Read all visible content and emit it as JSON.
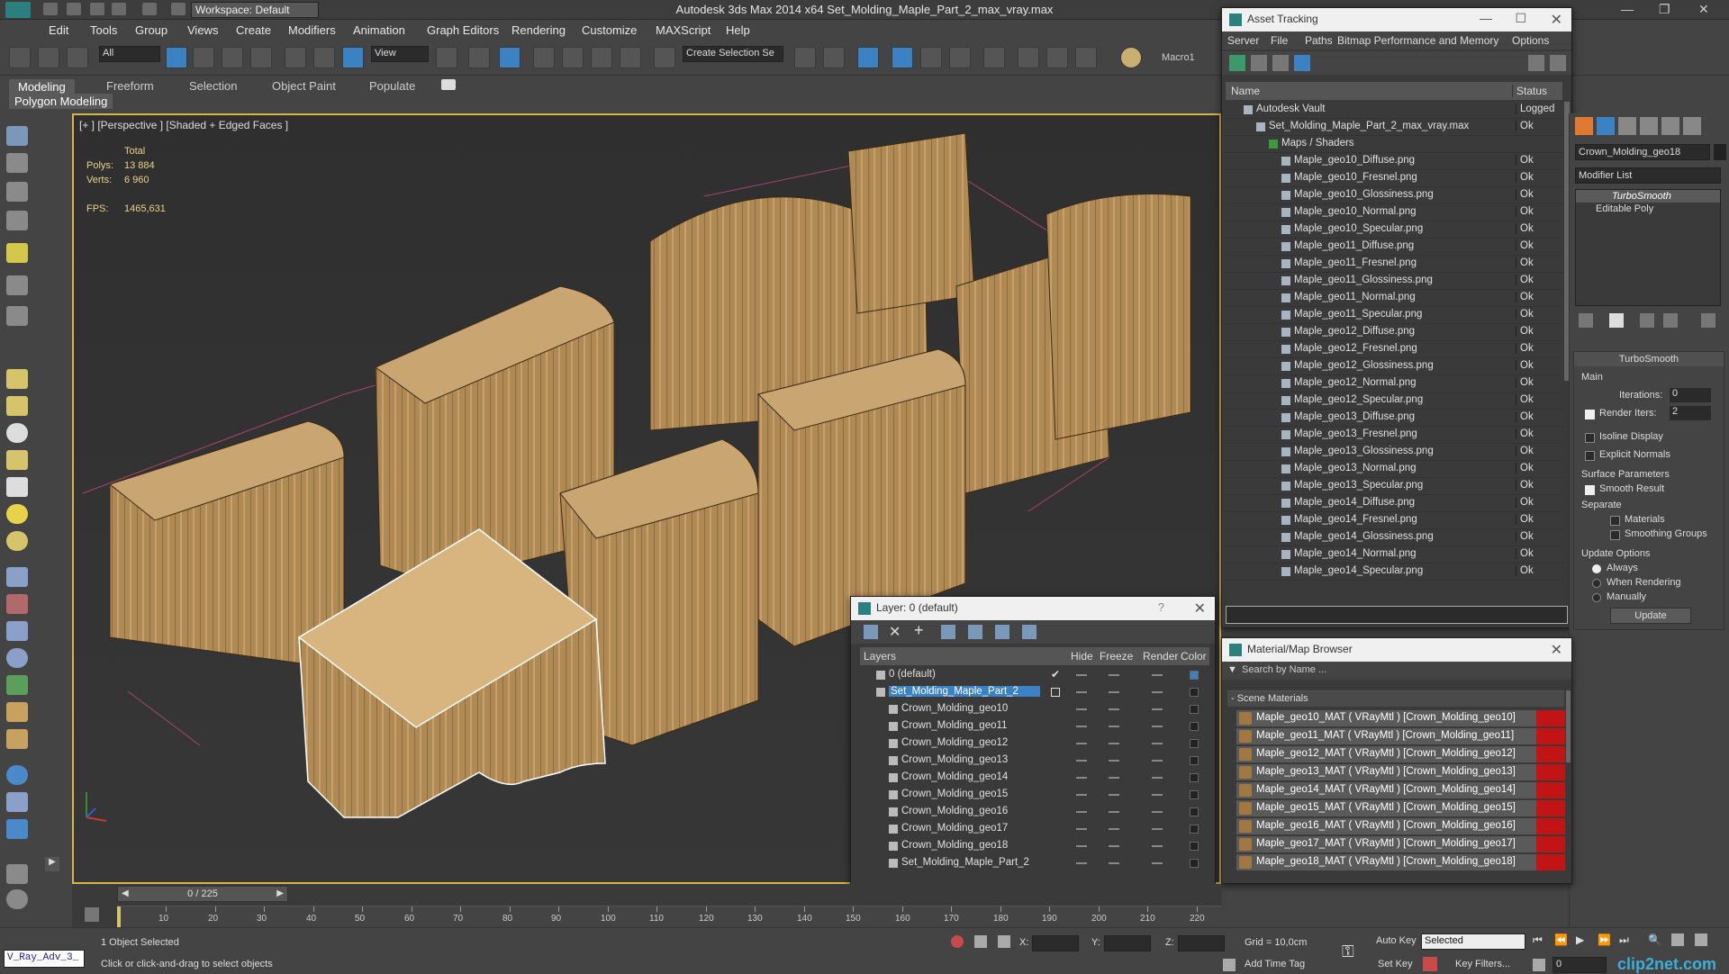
{
  "window": {
    "workspace": "Workspace: Default",
    "title": "Autodesk 3ds Max  2014 x64    Set_Molding_Maple_Part_2_max_vray.max"
  },
  "menu": [
    "Edit",
    "Tools",
    "Group",
    "Views",
    "Create",
    "Modifiers",
    "Animation",
    "Graph Editors",
    "Rendering",
    "Customize",
    "MAXScript",
    "Help"
  ],
  "toolbar": {
    "filter": "All",
    "ref_coord": "View",
    "selection_set": "Create Selection Se",
    "macro": "Macro1"
  },
  "ribbon": {
    "tabs": [
      "Modeling",
      "Freeform",
      "Selection",
      "Object Paint",
      "Populate"
    ],
    "panel": "Polygon Modeling"
  },
  "viewport": {
    "label": "[+ ] [Perspective ] [Shaded + Edged Faces ]",
    "stats": {
      "total_label": "Total",
      "polys_label": "Polys:",
      "polys": "13 884",
      "verts_label": "Verts:",
      "verts": "6 960",
      "fps_label": "FPS:",
      "fps": "1465,631"
    }
  },
  "asset_tracking": {
    "title": "Asset Tracking",
    "menu": [
      "Server",
      "File",
      "Paths",
      "Bitmap Performance and Memory",
      "Options"
    ],
    "col_name": "Name",
    "col_status": "Status",
    "rows": [
      {
        "name": "Autodesk Vault",
        "status": "Logged",
        "indent": 0
      },
      {
        "name": "Set_Molding_Maple_Part_2_max_vray.max",
        "status": "Ok",
        "indent": 1
      },
      {
        "name": "Maps / Shaders",
        "status": "",
        "indent": 2
      },
      {
        "name": "Maple_geo10_Diffuse.png",
        "status": "Ok",
        "indent": 3
      },
      {
        "name": "Maple_geo10_Fresnel.png",
        "status": "Ok",
        "indent": 3
      },
      {
        "name": "Maple_geo10_Glossiness.png",
        "status": "Ok",
        "indent": 3
      },
      {
        "name": "Maple_geo10_Normal.png",
        "status": "Ok",
        "indent": 3
      },
      {
        "name": "Maple_geo10_Specular.png",
        "status": "Ok",
        "indent": 3
      },
      {
        "name": "Maple_geo11_Diffuse.png",
        "status": "Ok",
        "indent": 3
      },
      {
        "name": "Maple_geo11_Fresnel.png",
        "status": "Ok",
        "indent": 3
      },
      {
        "name": "Maple_geo11_Glossiness.png",
        "status": "Ok",
        "indent": 3
      },
      {
        "name": "Maple_geo11_Normal.png",
        "status": "Ok",
        "indent": 3
      },
      {
        "name": "Maple_geo11_Specular.png",
        "status": "Ok",
        "indent": 3
      },
      {
        "name": "Maple_geo12_Diffuse.png",
        "status": "Ok",
        "indent": 3
      },
      {
        "name": "Maple_geo12_Fresnel.png",
        "status": "Ok",
        "indent": 3
      },
      {
        "name": "Maple_geo12_Glossiness.png",
        "status": "Ok",
        "indent": 3
      },
      {
        "name": "Maple_geo12_Normal.png",
        "status": "Ok",
        "indent": 3
      },
      {
        "name": "Maple_geo12_Specular.png",
        "status": "Ok",
        "indent": 3
      },
      {
        "name": "Maple_geo13_Diffuse.png",
        "status": "Ok",
        "indent": 3
      },
      {
        "name": "Maple_geo13_Fresnel.png",
        "status": "Ok",
        "indent": 3
      },
      {
        "name": "Maple_geo13_Glossiness.png",
        "status": "Ok",
        "indent": 3
      },
      {
        "name": "Maple_geo13_Normal.png",
        "status": "Ok",
        "indent": 3
      },
      {
        "name": "Maple_geo13_Specular.png",
        "status": "Ok",
        "indent": 3
      },
      {
        "name": "Maple_geo14_Diffuse.png",
        "status": "Ok",
        "indent": 3
      },
      {
        "name": "Maple_geo14_Fresnel.png",
        "status": "Ok",
        "indent": 3
      },
      {
        "name": "Maple_geo14_Glossiness.png",
        "status": "Ok",
        "indent": 3
      },
      {
        "name": "Maple_geo14_Normal.png",
        "status": "Ok",
        "indent": 3
      },
      {
        "name": "Maple_geo14_Specular.png",
        "status": "Ok",
        "indent": 3
      }
    ]
  },
  "layers": {
    "title": "Layer: 0 (default)",
    "col_layers": "Layers",
    "col_hide": "Hide",
    "col_freeze": "Freeze",
    "col_render": "Render",
    "col_color": "Color",
    "rows": [
      {
        "name": "0 (default)",
        "indent": 0,
        "selected": false
      },
      {
        "name": "Set_Molding_Maple_Part_2",
        "indent": 0,
        "selected": true
      },
      {
        "name": "Crown_Molding_geo10",
        "indent": 1,
        "selected": false
      },
      {
        "name": "Crown_Molding_geo11",
        "indent": 1,
        "selected": false
      },
      {
        "name": "Crown_Molding_geo12",
        "indent": 1,
        "selected": false
      },
      {
        "name": "Crown_Molding_geo13",
        "indent": 1,
        "selected": false
      },
      {
        "name": "Crown_Molding_geo14",
        "indent": 1,
        "selected": false
      },
      {
        "name": "Crown_Molding_geo15",
        "indent": 1,
        "selected": false
      },
      {
        "name": "Crown_Molding_geo16",
        "indent": 1,
        "selected": false
      },
      {
        "name": "Crown_Molding_geo17",
        "indent": 1,
        "selected": false
      },
      {
        "name": "Crown_Molding_geo18",
        "indent": 1,
        "selected": false
      },
      {
        "name": "Set_Molding_Maple_Part_2",
        "indent": 1,
        "selected": false
      }
    ]
  },
  "material_browser": {
    "title": "Material/Map Browser",
    "search_placeholder": "Search by Name ...",
    "section": "- Scene Materials",
    "materials": [
      "Maple_geo10_MAT ( VRayMtl ) [Crown_Molding_geo10]",
      "Maple_geo11_MAT ( VRayMtl ) [Crown_Molding_geo11]",
      "Maple_geo12_MAT ( VRayMtl ) [Crown_Molding_geo12]",
      "Maple_geo13_MAT ( VRayMtl ) [Crown_Molding_geo13]",
      "Maple_geo14_MAT ( VRayMtl ) [Crown_Molding_geo14]",
      "Maple_geo15_MAT ( VRayMtl ) [Crown_Molding_geo15]",
      "Maple_geo16_MAT ( VRayMtl ) [Crown_Molding_geo16]",
      "Maple_geo17_MAT ( VRayMtl ) [Crown_Molding_geo17]",
      "Maple_geo18_MAT ( VRayMtl ) [Crown_Molding_geo18]"
    ]
  },
  "command_panel": {
    "object_name": "Crown_Molding_geo18",
    "modifier_list": "Modifier List",
    "stack": [
      "TurboSmooth",
      "Editable Poly"
    ],
    "rollout": "TurboSmooth",
    "main": "Main",
    "iterations_label": "Iterations:",
    "iterations": "0",
    "render_iters_label": "Render Iters:",
    "render_iters": "2",
    "isoline": "Isoline Display",
    "explicit_normals": "Explicit Normals",
    "surface_params": "Surface Parameters",
    "smooth_result": "Smooth Result",
    "separate": "Separate",
    "materials": "Materials",
    "smoothing_groups": "Smoothing Groups",
    "update_options": "Update Options",
    "always": "Always",
    "when_rendering": "When Rendering",
    "manually": "Manually",
    "update_button": "Update"
  },
  "timeline": {
    "frame": "0 / 225",
    "ticks": [
      "10",
      "20",
      "30",
      "40",
      "50",
      "60",
      "70",
      "80",
      "90",
      "100",
      "110",
      "120",
      "130",
      "140",
      "150",
      "160",
      "170",
      "180",
      "190",
      "200",
      "210",
      "220"
    ]
  },
  "status": {
    "script_label": "V_Ray_Adv_3_",
    "selected": "1 Object Selected",
    "prompt": "Click or click-and-drag to select objects",
    "x_label": "X:",
    "y_label": "Y:",
    "z_label": "Z:",
    "grid": "Grid = 10,0cm",
    "auto_key": "Auto Key",
    "set_key": "Set Key",
    "selected_dd": "Selected",
    "key_filters": "Key Filters...",
    "add_time_tag": "Add Time Tag",
    "frame_field": "0",
    "watermark": "clip2net.com"
  },
  "colors": {
    "accent": "#3b82c4",
    "viewport_border": "#d6b44a",
    "material_swatch": "#c21414",
    "wood": "#b08a55"
  }
}
